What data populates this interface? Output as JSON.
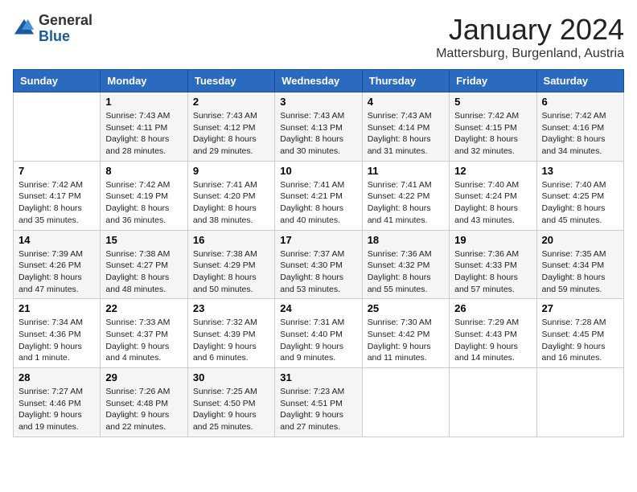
{
  "logo": {
    "general": "General",
    "blue": "Blue"
  },
  "title": "January 2024",
  "location": "Mattersburg, Burgenland, Austria",
  "days_header": [
    "Sunday",
    "Monday",
    "Tuesday",
    "Wednesday",
    "Thursday",
    "Friday",
    "Saturday"
  ],
  "weeks": [
    [
      {
        "day": "",
        "sunrise": "",
        "sunset": "",
        "daylight": ""
      },
      {
        "day": "1",
        "sunrise": "Sunrise: 7:43 AM",
        "sunset": "Sunset: 4:11 PM",
        "daylight": "Daylight: 8 hours and 28 minutes."
      },
      {
        "day": "2",
        "sunrise": "Sunrise: 7:43 AM",
        "sunset": "Sunset: 4:12 PM",
        "daylight": "Daylight: 8 hours and 29 minutes."
      },
      {
        "day": "3",
        "sunrise": "Sunrise: 7:43 AM",
        "sunset": "Sunset: 4:13 PM",
        "daylight": "Daylight: 8 hours and 30 minutes."
      },
      {
        "day": "4",
        "sunrise": "Sunrise: 7:43 AM",
        "sunset": "Sunset: 4:14 PM",
        "daylight": "Daylight: 8 hours and 31 minutes."
      },
      {
        "day": "5",
        "sunrise": "Sunrise: 7:42 AM",
        "sunset": "Sunset: 4:15 PM",
        "daylight": "Daylight: 8 hours and 32 minutes."
      },
      {
        "day": "6",
        "sunrise": "Sunrise: 7:42 AM",
        "sunset": "Sunset: 4:16 PM",
        "daylight": "Daylight: 8 hours and 34 minutes."
      }
    ],
    [
      {
        "day": "7",
        "sunrise": "Sunrise: 7:42 AM",
        "sunset": "Sunset: 4:17 PM",
        "daylight": "Daylight: 8 hours and 35 minutes."
      },
      {
        "day": "8",
        "sunrise": "Sunrise: 7:42 AM",
        "sunset": "Sunset: 4:19 PM",
        "daylight": "Daylight: 8 hours and 36 minutes."
      },
      {
        "day": "9",
        "sunrise": "Sunrise: 7:41 AM",
        "sunset": "Sunset: 4:20 PM",
        "daylight": "Daylight: 8 hours and 38 minutes."
      },
      {
        "day": "10",
        "sunrise": "Sunrise: 7:41 AM",
        "sunset": "Sunset: 4:21 PM",
        "daylight": "Daylight: 8 hours and 40 minutes."
      },
      {
        "day": "11",
        "sunrise": "Sunrise: 7:41 AM",
        "sunset": "Sunset: 4:22 PM",
        "daylight": "Daylight: 8 hours and 41 minutes."
      },
      {
        "day": "12",
        "sunrise": "Sunrise: 7:40 AM",
        "sunset": "Sunset: 4:24 PM",
        "daylight": "Daylight: 8 hours and 43 minutes."
      },
      {
        "day": "13",
        "sunrise": "Sunrise: 7:40 AM",
        "sunset": "Sunset: 4:25 PM",
        "daylight": "Daylight: 8 hours and 45 minutes."
      }
    ],
    [
      {
        "day": "14",
        "sunrise": "Sunrise: 7:39 AM",
        "sunset": "Sunset: 4:26 PM",
        "daylight": "Daylight: 8 hours and 47 minutes."
      },
      {
        "day": "15",
        "sunrise": "Sunrise: 7:38 AM",
        "sunset": "Sunset: 4:27 PM",
        "daylight": "Daylight: 8 hours and 48 minutes."
      },
      {
        "day": "16",
        "sunrise": "Sunrise: 7:38 AM",
        "sunset": "Sunset: 4:29 PM",
        "daylight": "Daylight: 8 hours and 50 minutes."
      },
      {
        "day": "17",
        "sunrise": "Sunrise: 7:37 AM",
        "sunset": "Sunset: 4:30 PM",
        "daylight": "Daylight: 8 hours and 53 minutes."
      },
      {
        "day": "18",
        "sunrise": "Sunrise: 7:36 AM",
        "sunset": "Sunset: 4:32 PM",
        "daylight": "Daylight: 8 hours and 55 minutes."
      },
      {
        "day": "19",
        "sunrise": "Sunrise: 7:36 AM",
        "sunset": "Sunset: 4:33 PM",
        "daylight": "Daylight: 8 hours and 57 minutes."
      },
      {
        "day": "20",
        "sunrise": "Sunrise: 7:35 AM",
        "sunset": "Sunset: 4:34 PM",
        "daylight": "Daylight: 8 hours and 59 minutes."
      }
    ],
    [
      {
        "day": "21",
        "sunrise": "Sunrise: 7:34 AM",
        "sunset": "Sunset: 4:36 PM",
        "daylight": "Daylight: 9 hours and 1 minute."
      },
      {
        "day": "22",
        "sunrise": "Sunrise: 7:33 AM",
        "sunset": "Sunset: 4:37 PM",
        "daylight": "Daylight: 9 hours and 4 minutes."
      },
      {
        "day": "23",
        "sunrise": "Sunrise: 7:32 AM",
        "sunset": "Sunset: 4:39 PM",
        "daylight": "Daylight: 9 hours and 6 minutes."
      },
      {
        "day": "24",
        "sunrise": "Sunrise: 7:31 AM",
        "sunset": "Sunset: 4:40 PM",
        "daylight": "Daylight: 9 hours and 9 minutes."
      },
      {
        "day": "25",
        "sunrise": "Sunrise: 7:30 AM",
        "sunset": "Sunset: 4:42 PM",
        "daylight": "Daylight: 9 hours and 11 minutes."
      },
      {
        "day": "26",
        "sunrise": "Sunrise: 7:29 AM",
        "sunset": "Sunset: 4:43 PM",
        "daylight": "Daylight: 9 hours and 14 minutes."
      },
      {
        "day": "27",
        "sunrise": "Sunrise: 7:28 AM",
        "sunset": "Sunset: 4:45 PM",
        "daylight": "Daylight: 9 hours and 16 minutes."
      }
    ],
    [
      {
        "day": "28",
        "sunrise": "Sunrise: 7:27 AM",
        "sunset": "Sunset: 4:46 PM",
        "daylight": "Daylight: 9 hours and 19 minutes."
      },
      {
        "day": "29",
        "sunrise": "Sunrise: 7:26 AM",
        "sunset": "Sunset: 4:48 PM",
        "daylight": "Daylight: 9 hours and 22 minutes."
      },
      {
        "day": "30",
        "sunrise": "Sunrise: 7:25 AM",
        "sunset": "Sunset: 4:50 PM",
        "daylight": "Daylight: 9 hours and 25 minutes."
      },
      {
        "day": "31",
        "sunrise": "Sunrise: 7:23 AM",
        "sunset": "Sunset: 4:51 PM",
        "daylight": "Daylight: 9 hours and 27 minutes."
      },
      {
        "day": "",
        "sunrise": "",
        "sunset": "",
        "daylight": ""
      },
      {
        "day": "",
        "sunrise": "",
        "sunset": "",
        "daylight": ""
      },
      {
        "day": "",
        "sunrise": "",
        "sunset": "",
        "daylight": ""
      }
    ]
  ]
}
